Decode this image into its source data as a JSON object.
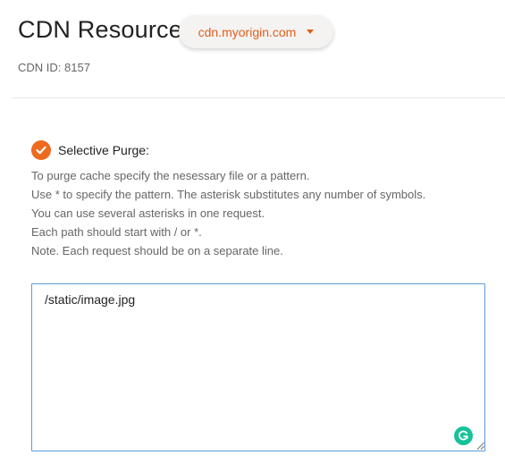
{
  "header": {
    "title": "CDN Resource:",
    "resource_selected": "cdn.myorigin.com",
    "cdn_id_text": "CDN ID: 8157"
  },
  "purge": {
    "option_label": "Selective Purge:",
    "option_checked": true,
    "instructions": [
      "To purge cache specify the nesessary file or a pattern.",
      "Use * to specify the pattern. The asterisk substitutes any number of symbols.",
      "You can use several asterisks in one request.",
      "Each path should start with / or *.",
      "Note. Each request should be on a separate line."
    ],
    "textarea_value": "/static/image.jpg"
  },
  "colors": {
    "accent": "#ee6a1e",
    "link": "#e25d1a",
    "focus_border": "#5b9bd5",
    "grammarly": "#15c39a"
  },
  "icons": {
    "check": "check-circle-icon",
    "caret": "caret-down-icon",
    "grammarly": "grammarly-icon",
    "resize": "resize-handle-icon"
  }
}
